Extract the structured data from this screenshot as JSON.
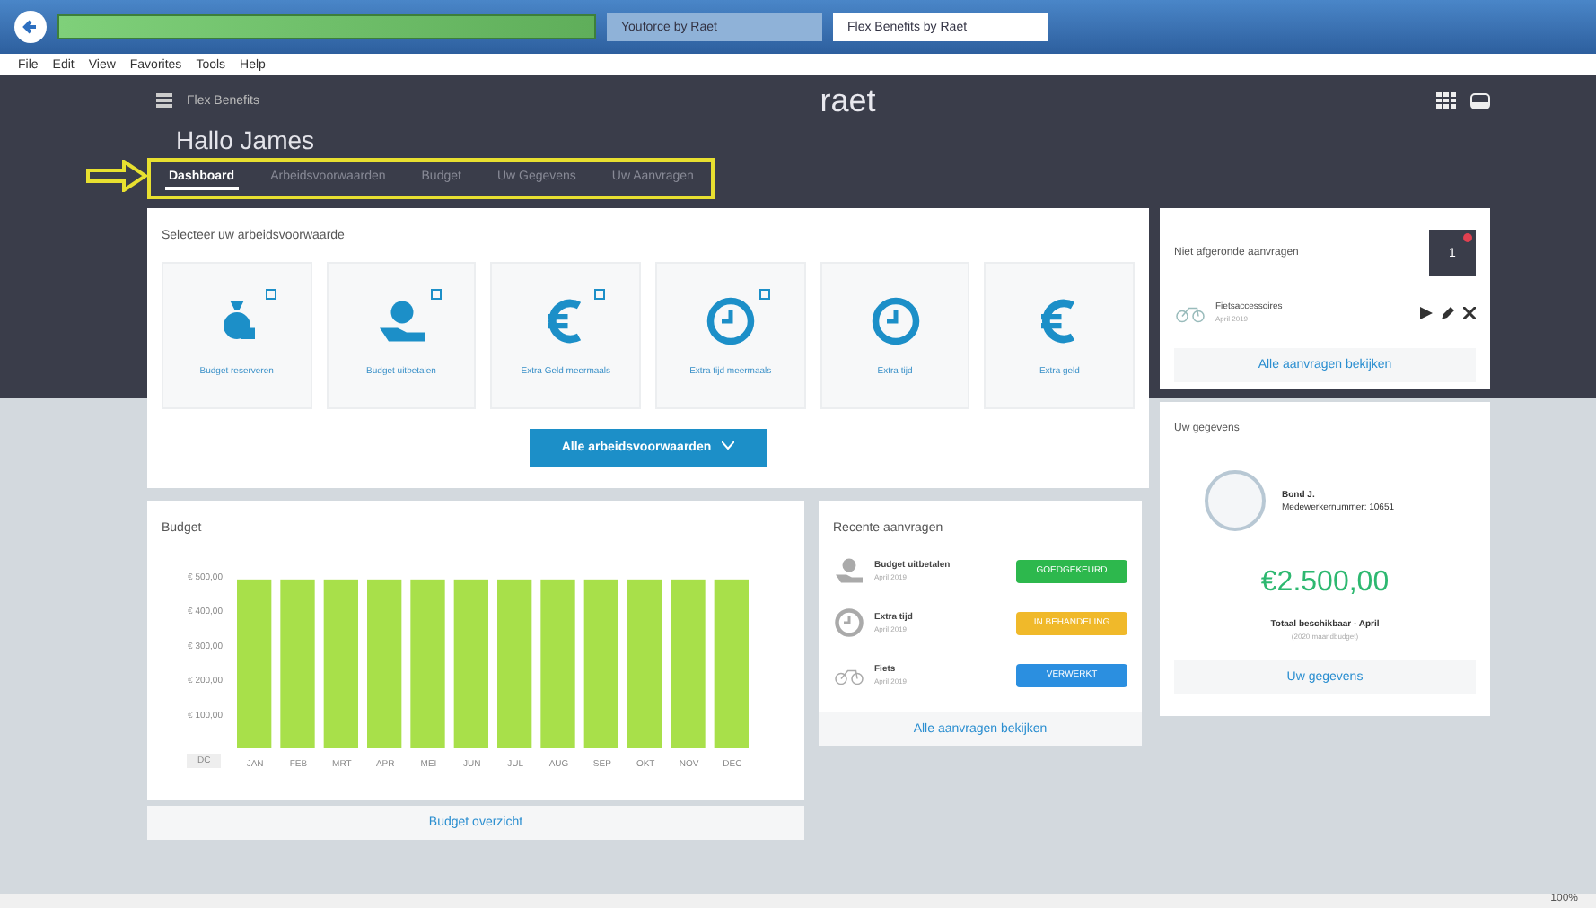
{
  "browser": {
    "tabs": [
      {
        "label": "Youforce by Raet",
        "selected": false
      },
      {
        "label": "Flex Benefits by Raet",
        "selected": true
      }
    ],
    "menu": [
      "File",
      "Edit",
      "View",
      "Favorites",
      "Tools",
      "Help"
    ],
    "status": "100%"
  },
  "header": {
    "app_name": "Flex Benefits",
    "logo": "raet",
    "greeting": "Hallo James",
    "tabs": [
      {
        "label": "Dashboard",
        "selected": true
      },
      {
        "label": "Arbeidsvoorwaarden",
        "selected": false
      },
      {
        "label": "Budget",
        "selected": false
      },
      {
        "label": "Uw Gegevens",
        "selected": false
      },
      {
        "label": "Uw Aanvragen",
        "selected": false
      }
    ]
  },
  "benefits": {
    "title": "Selecteer uw arbeidsvoorwaarde",
    "button": "Alle arbeidsvoorwaarden",
    "tiles": [
      {
        "label": "Budget reserveren",
        "kind": "moneybag",
        "recurring": true
      },
      {
        "label": "Budget uitbetalen",
        "kind": "hand",
        "recurring": true
      },
      {
        "label": "Extra Geld meermaals",
        "kind": "euro",
        "recurring": true
      },
      {
        "label": "Extra tijd meermaals",
        "kind": "clock",
        "recurring": true
      },
      {
        "label": "Extra tijd",
        "kind": "clock",
        "recurring": false
      },
      {
        "label": "Extra geld",
        "kind": "euro",
        "recurring": false
      }
    ]
  },
  "budget": {
    "title": "Budget",
    "range_label": "DC",
    "link": "Budget overzicht",
    "chart_data": {
      "type": "bar",
      "categories": [
        "JAN",
        "FEB",
        "MRT",
        "APR",
        "MEI",
        "JUN",
        "JUL",
        "AUG",
        "SEP",
        "OKT",
        "NOV",
        "DEC"
      ],
      "series": [
        {
          "color": "#a8e04a",
          "values": [
            490,
            490,
            490,
            490,
            490,
            490,
            490,
            490,
            490,
            490,
            490,
            490
          ]
        }
      ],
      "ylim": [
        0,
        500
      ],
      "yticks": [
        {
          "value": 100,
          "label": "€ 100,00"
        },
        {
          "value": 200,
          "label": "€ 200,00"
        },
        {
          "value": 300,
          "label": "€ 300,00"
        },
        {
          "value": 400,
          "label": "€ 400,00"
        },
        {
          "value": 500,
          "label": "€ 500,00"
        }
      ]
    }
  },
  "recent": {
    "title": "Recente aanvragen",
    "link": "Alle aanvragen bekijken",
    "items": [
      {
        "name": "Budget uitbetalen",
        "date": "April 2019",
        "status": "GOEDGEKEURD",
        "color": "#2db84d",
        "kind": "hand"
      },
      {
        "name": "Extra tijd",
        "date": "April 2019",
        "status": "IN BEHANDELING",
        "color": "#f0b92a",
        "kind": "clock"
      },
      {
        "name": "Fiets",
        "date": "April 2019",
        "status": "VERWERKT",
        "color": "#2b8fe0",
        "kind": "bike"
      }
    ]
  },
  "pending": {
    "title": "Niet afgeronde aanvragen",
    "badge": "1",
    "item": {
      "name": "Fietsaccessoires",
      "date": "April 2019"
    },
    "link": "Alle aanvragen bekijken"
  },
  "profile": {
    "title": "Uw gegevens",
    "name": "Bond J.",
    "employee": "Medewerkernummer: 10651",
    "amount": "€2.500,00",
    "amount_label": "Totaal beschikbaar - April",
    "amount_sub": "(2020 maandbudget)",
    "link": "Uw gegevens"
  }
}
